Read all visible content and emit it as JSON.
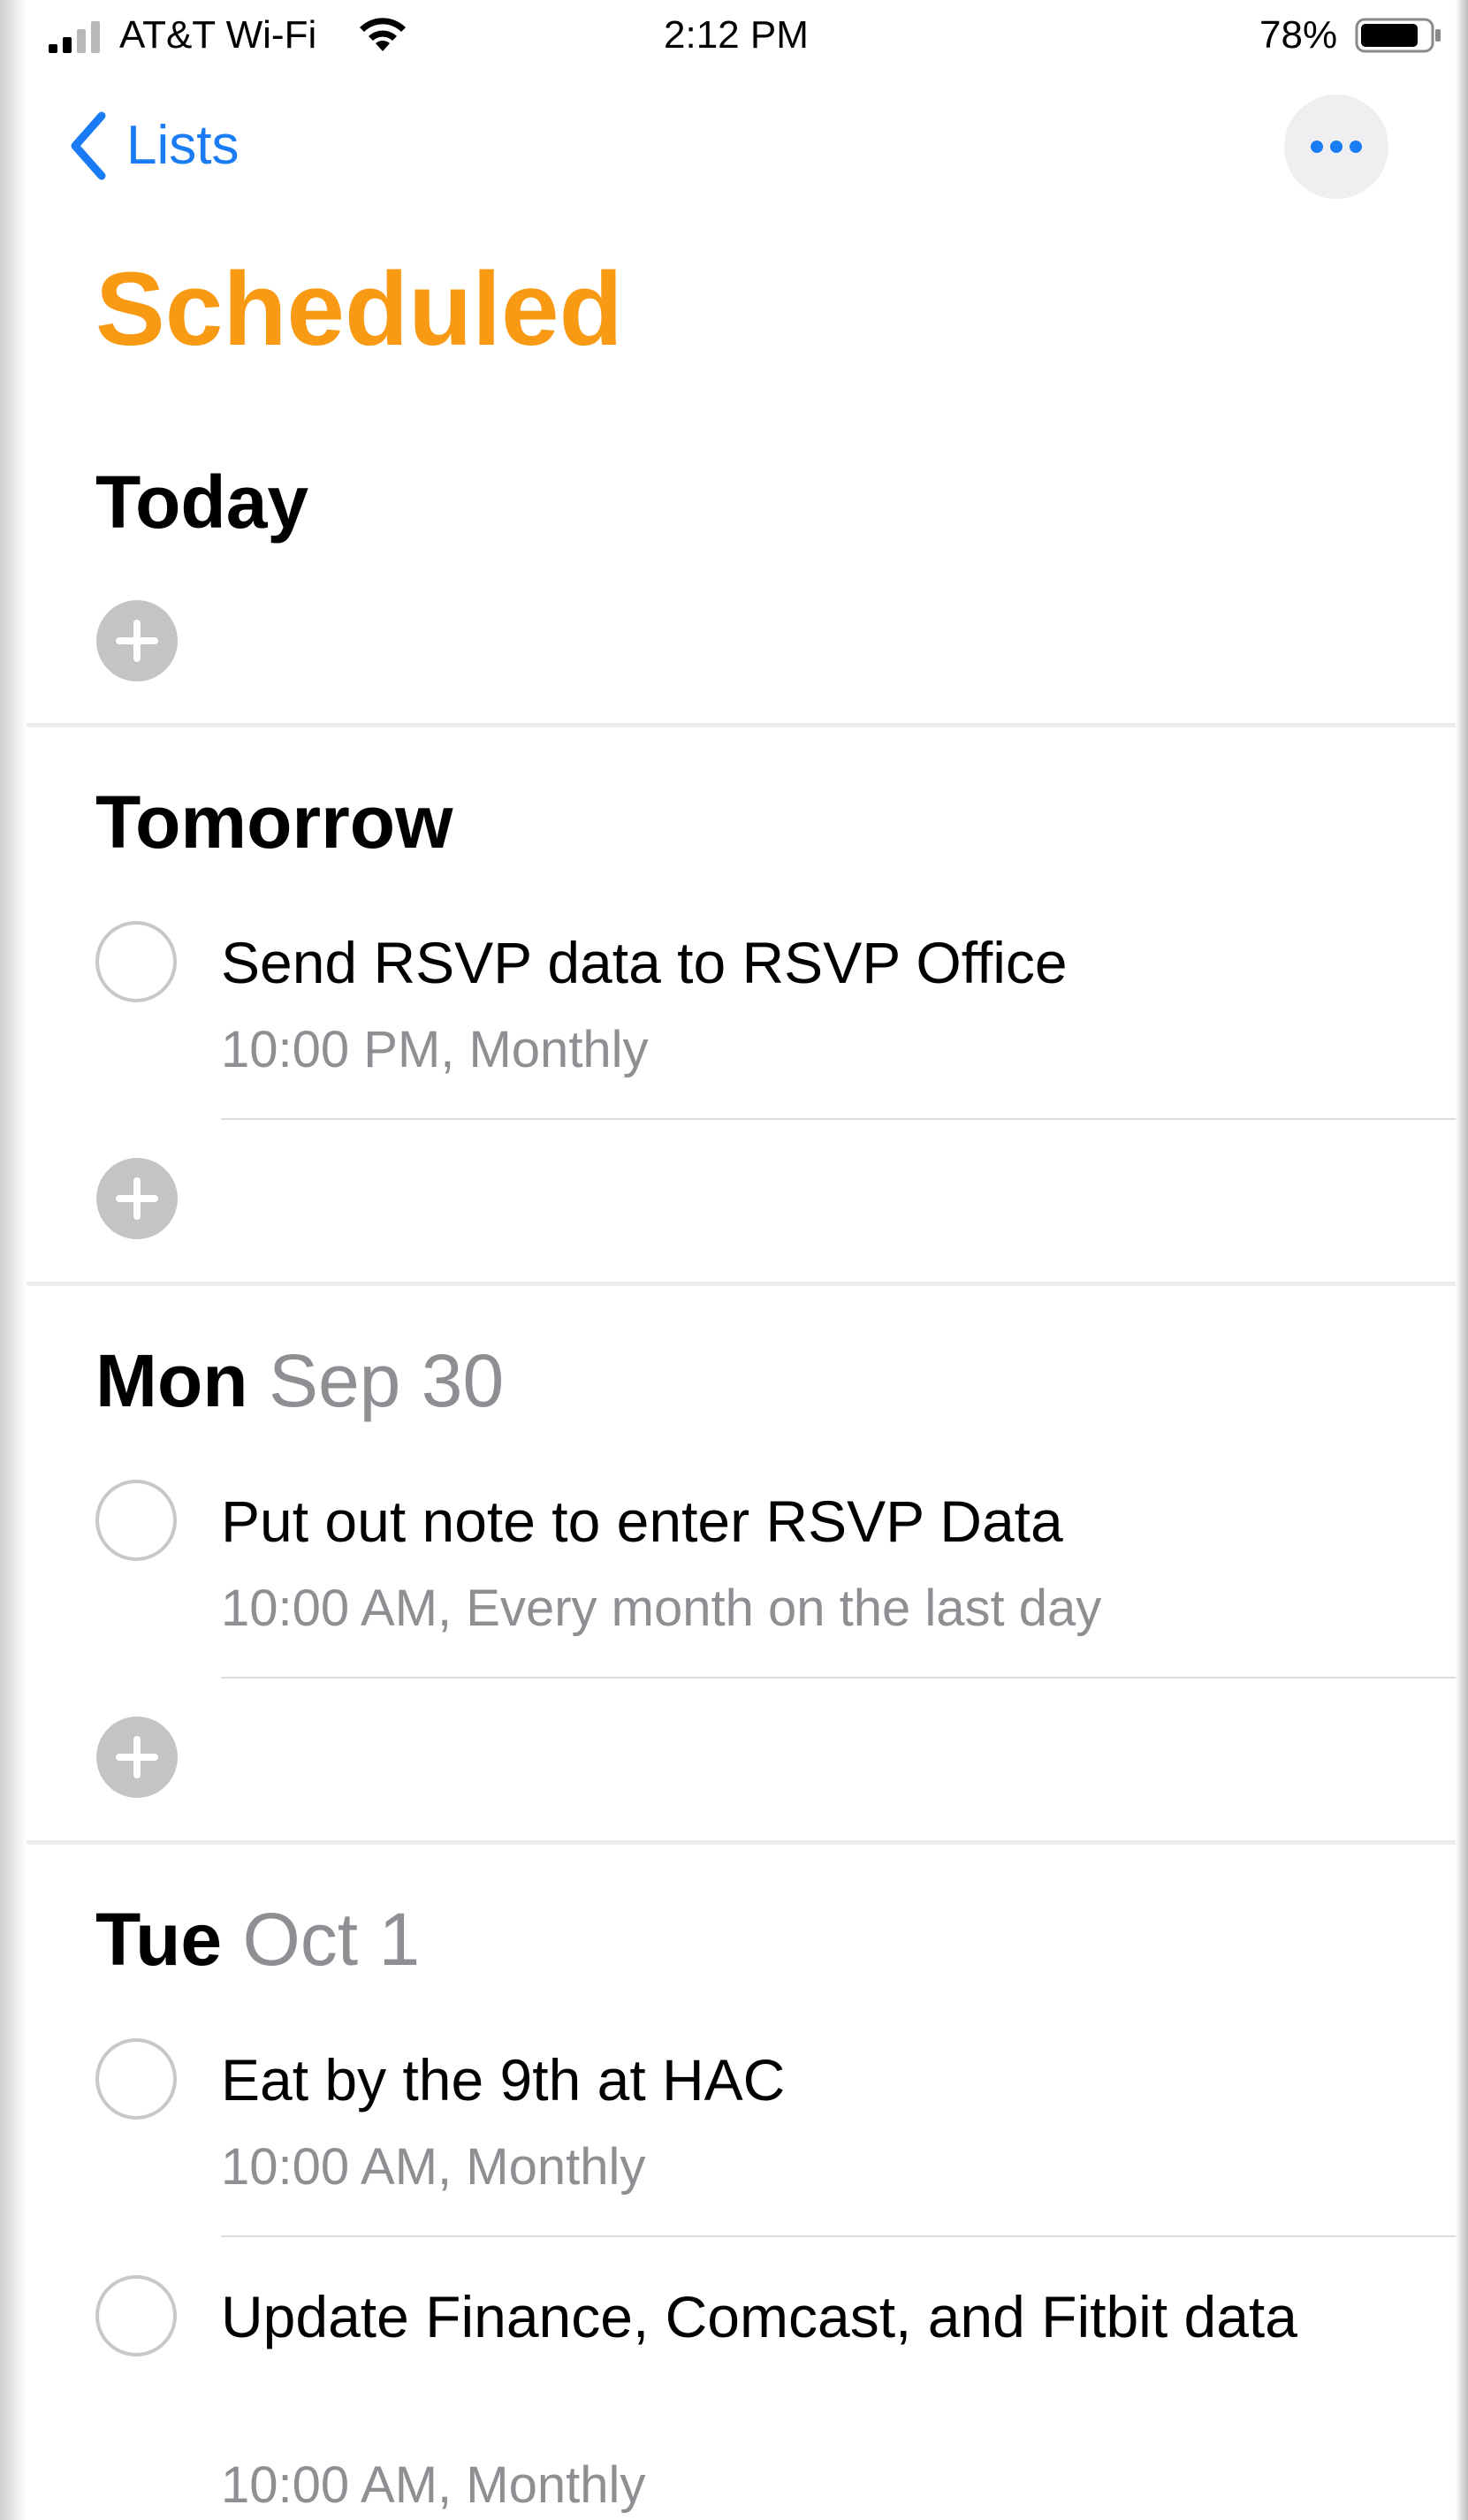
{
  "status_bar": {
    "carrier": "AT&T Wi-Fi",
    "time": "2:12 PM",
    "battery_percent": "78%"
  },
  "nav": {
    "back_label": "Lists"
  },
  "page_title": "Scheduled",
  "colors": {
    "accent_blue": "#1a7cf5",
    "title_orange": "#f99a14",
    "secondary_gray": "#8e8e93"
  },
  "sections": [
    {
      "label": "Today",
      "sublabel": ""
    },
    {
      "label": "Tomorrow",
      "sublabel": ""
    },
    {
      "label": "Mon",
      "sublabel": "Sep 30"
    },
    {
      "label": "Tue",
      "sublabel": "Oct 1"
    }
  ],
  "tasks": [
    {
      "title": "Send RSVP data to RSVP Office",
      "meta": "10:00 PM, Monthly"
    },
    {
      "title": "Put out note to enter RSVP Data",
      "meta": "10:00 AM, Every month on the last day"
    },
    {
      "title": "Eat by the 9th at HAC",
      "meta": "10:00 AM, Monthly"
    },
    {
      "title": "Update Finance, Comcast, and Fitbit data",
      "meta": "10:00 AM, Monthly"
    }
  ],
  "icons": {
    "signal": "cellular-signal-icon",
    "wifi": "wifi-icon",
    "battery": "battery-icon",
    "back": "chevron-left-icon",
    "more": "ellipsis-icon",
    "add": "plus-circle-icon"
  }
}
